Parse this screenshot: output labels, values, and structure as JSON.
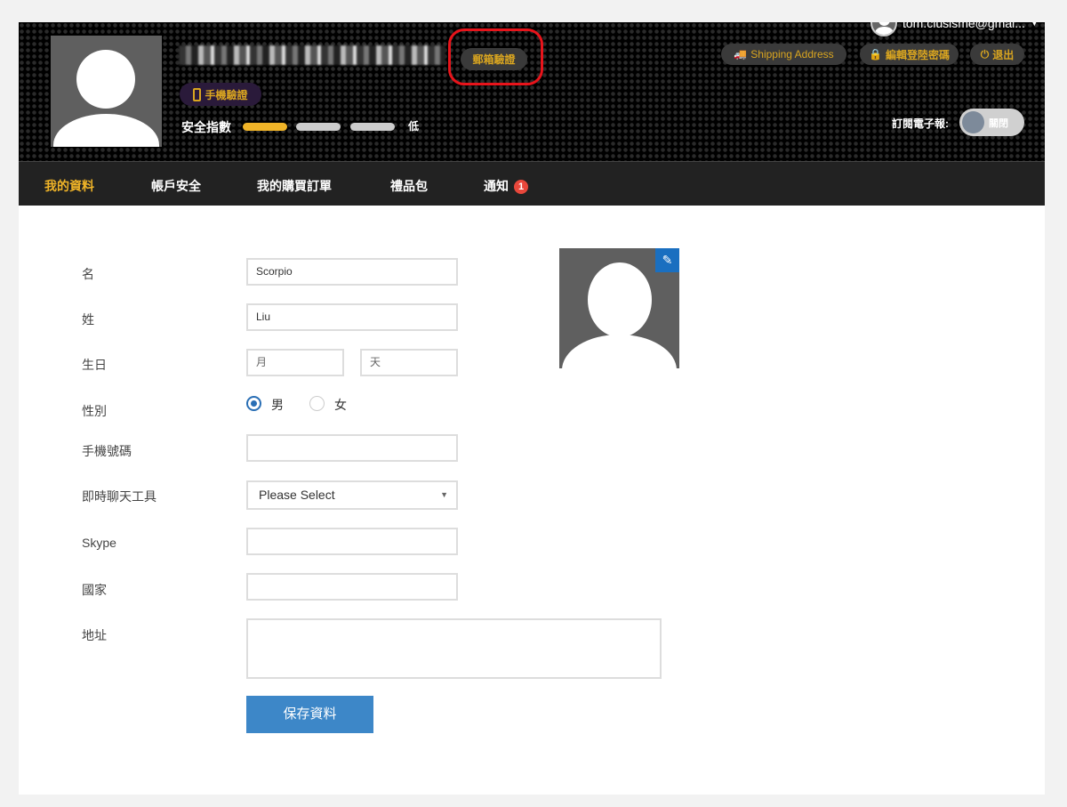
{
  "header": {
    "user_email": "tom.ciusisme@gmai...",
    "email_verify": "郵箱驗證",
    "phone_verify": "手機驗證",
    "security_label": "安全指數",
    "security_level": "低",
    "security_score": 1,
    "security_max": 3,
    "shipping_address": "Shipping Address",
    "edit_password": "編輯登陸密碼",
    "logout": "退出",
    "newsletter_label": "訂閱電子報:",
    "newsletter_toggle": "關閉"
  },
  "nav": {
    "items": [
      {
        "label": "我的資料"
      },
      {
        "label": "帳戶安全"
      },
      {
        "label": "我的購買訂單"
      },
      {
        "label": "禮品包"
      },
      {
        "label": "通知",
        "badge": "1"
      }
    ]
  },
  "form": {
    "first_name_label": "名",
    "first_name": "Scorpio",
    "last_name_label": "姓",
    "last_name": "Liu",
    "birthday_label": "生日",
    "month_placeholder": "月",
    "day_placeholder": "天",
    "gender_label": "性別",
    "male": "男",
    "female": "女",
    "phone_label": "手機號碼",
    "chat_label": "即時聊天工具",
    "chat_value": "Please Select",
    "skype_label": "Skype",
    "country_label": "國家",
    "address_label": "地址",
    "save": "保存資料"
  },
  "colors": {
    "accent": "#f0b428",
    "button": "#3d87c8",
    "highlight": "#e8141b"
  }
}
